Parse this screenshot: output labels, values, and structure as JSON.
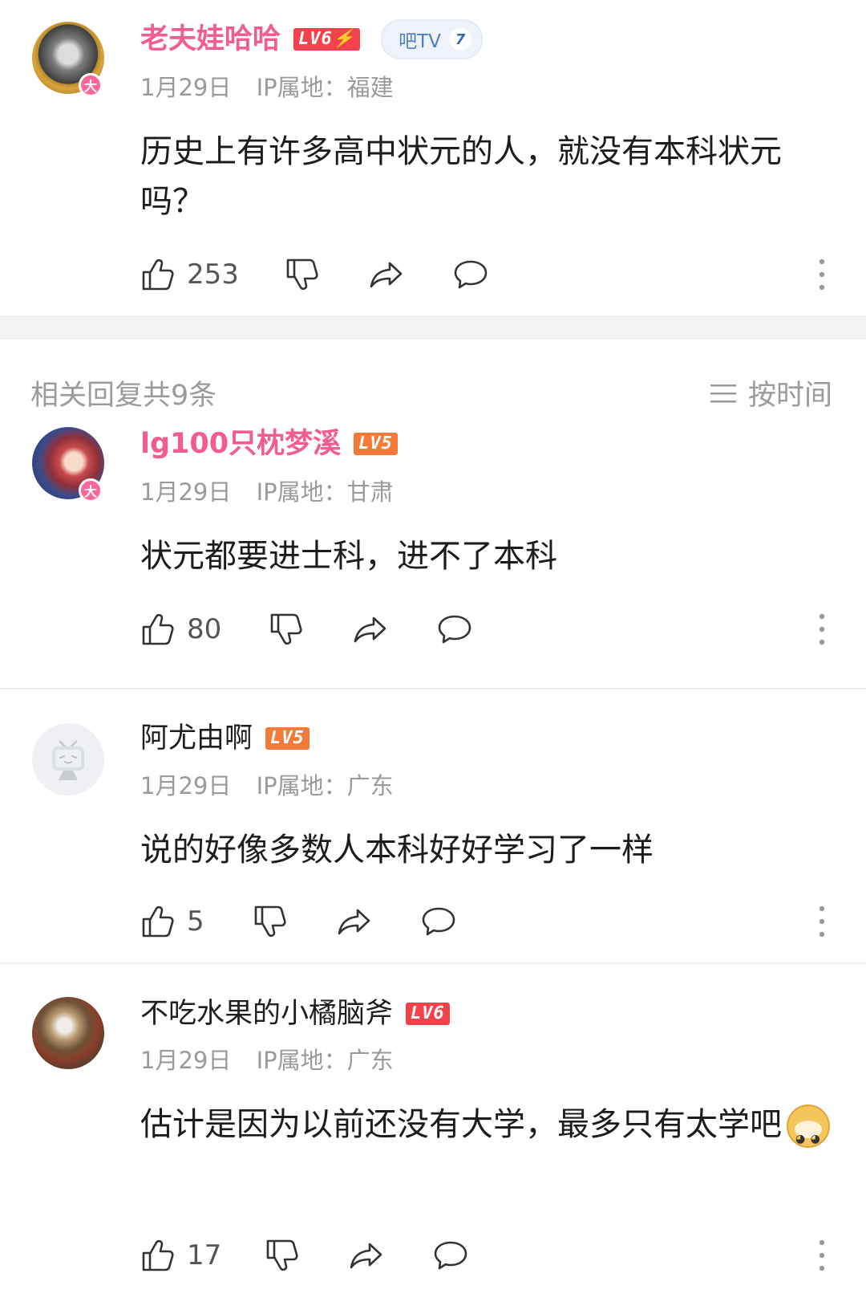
{
  "post": {
    "username": "老夫娃哈哈",
    "level": "LV6⚡",
    "tv_badge": {
      "label": "吧TV",
      "count": "7"
    },
    "date": "1月29日",
    "ip": "IP属地：福建",
    "text": "历史上有许多高中状元的人，就没有本科状元吗？",
    "likes": "253",
    "vip_badge": "大"
  },
  "section": {
    "replies_label": "相关回复共9条",
    "sort_label": "按时间"
  },
  "replies": [
    {
      "username": "lg100只枕梦溪",
      "level": "LV5",
      "date": "1月29日",
      "ip": "IP属地：甘肃",
      "text": "状元都要进士科，进不了本科",
      "likes": "80",
      "vip_badge": "大"
    },
    {
      "username": "阿尤由啊",
      "level": "LV5",
      "date": "1月29日",
      "ip": "IP属地：广东",
      "text": "说的好像多数人本科好好学习了一样",
      "likes": "5"
    },
    {
      "username": "不吃水果的小橘脑斧",
      "level": "LV6",
      "date": "1月29日",
      "ip": "IP属地：广东",
      "text": "估计是因为以前还没有大学，最多只有太学吧",
      "emoji": "doge",
      "likes": "17"
    }
  ],
  "colors": {
    "vip_name": "#f25d8e",
    "level_badge": "#f37a39",
    "meta_gray": "#9a9a9a",
    "divider": "#ececec"
  },
  "icons": [
    "thumb-up-icon",
    "thumb-down-icon",
    "share-icon",
    "comment-icon",
    "more-vertical-icon",
    "sort-icon"
  ]
}
